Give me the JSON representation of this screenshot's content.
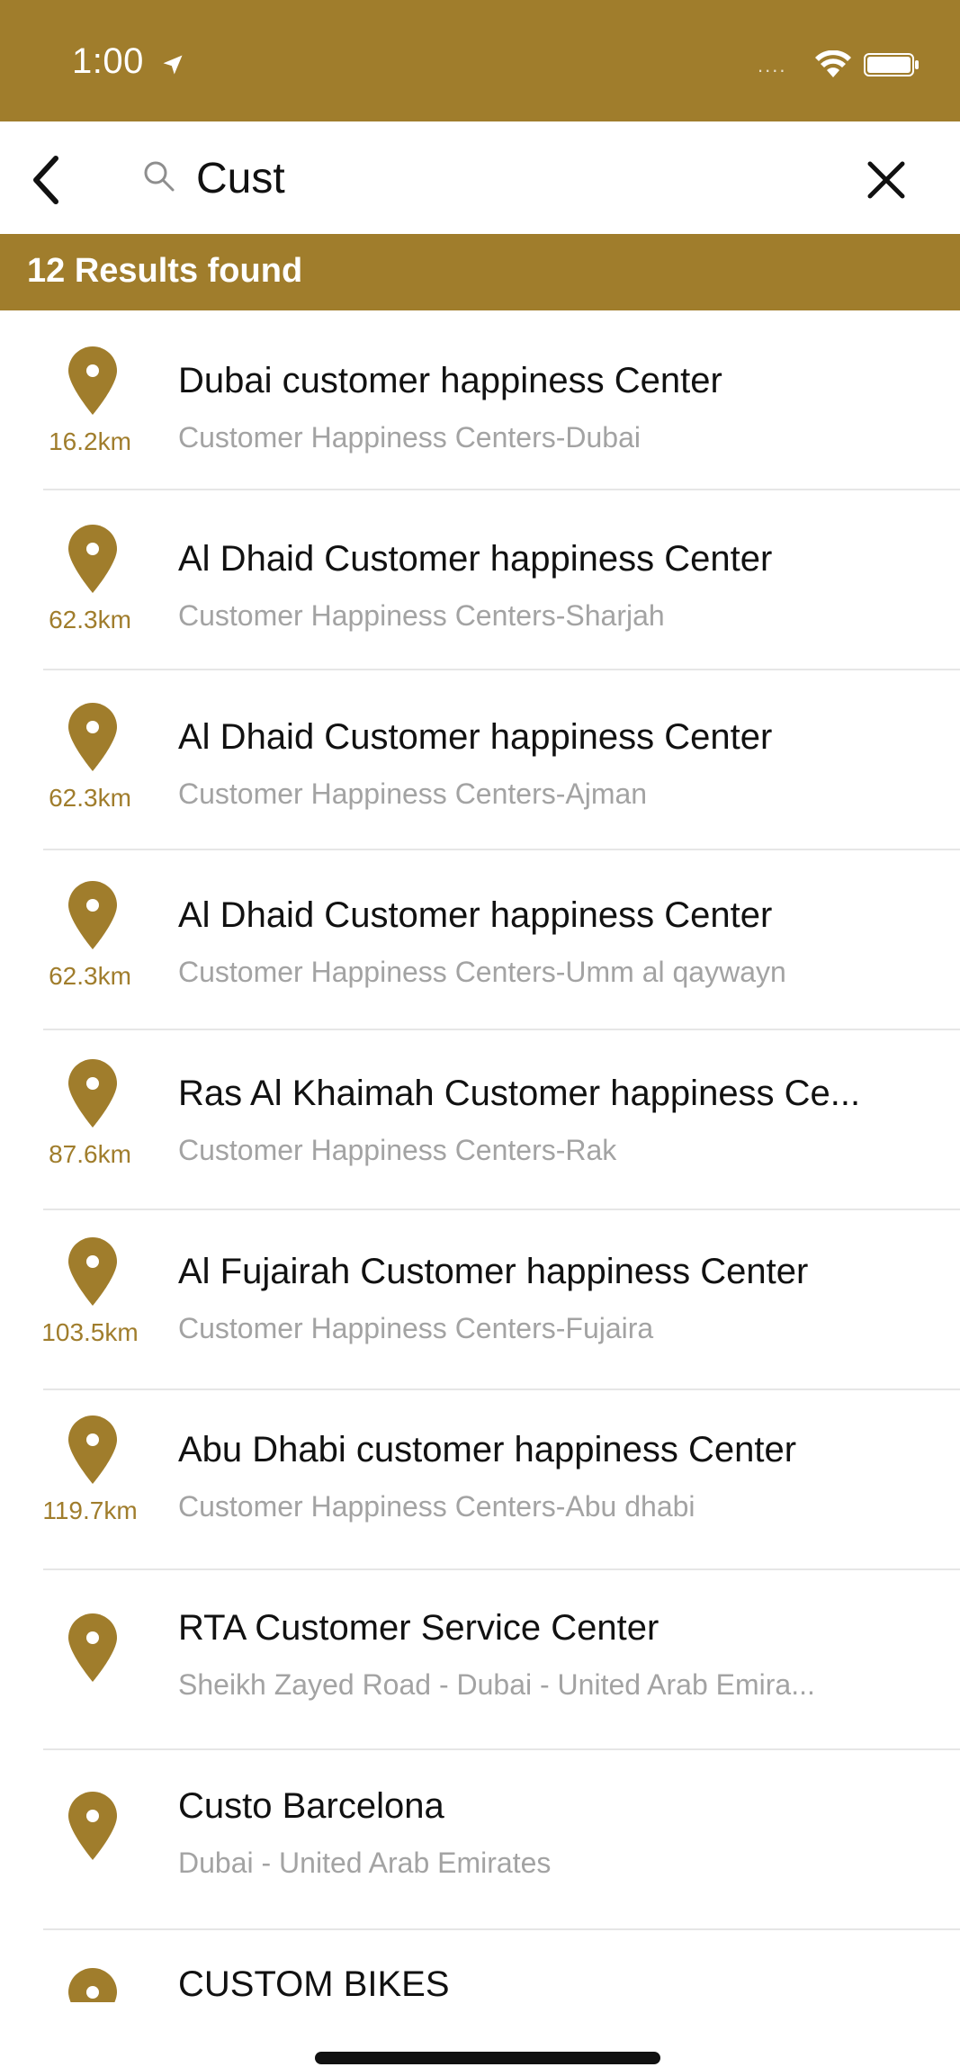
{
  "status_bar": {
    "time": "1:00",
    "location_icon": "location-arrow-icon",
    "dots": "....",
    "wifi_icon": "wifi-icon",
    "battery_icon": "battery-icon"
  },
  "search": {
    "back_icon": "chevron-left-icon",
    "search_icon": "search-icon",
    "value": "Cust",
    "clear_icon": "close-icon"
  },
  "results": {
    "label": "12 Results found"
  },
  "colors": {
    "brand": "#a07d2c",
    "subtitle": "#a3a3a3"
  },
  "items": [
    {
      "title": "Dubai customer happiness Center",
      "subtitle": "Customer Happiness Centers-Dubai",
      "distance": "16.2km"
    },
    {
      "title": "Al Dhaid Customer happiness Center",
      "subtitle": "Customer Happiness Centers-Sharjah",
      "distance": "62.3km"
    },
    {
      "title": "Al Dhaid Customer happiness Center",
      "subtitle": "Customer Happiness Centers-Ajman",
      "distance": "62.3km"
    },
    {
      "title": "Al Dhaid Customer happiness Center",
      "subtitle": "Customer Happiness Centers-Umm al qaywayn",
      "distance": "62.3km"
    },
    {
      "title": "Ras Al Khaimah Customer happiness Ce...",
      "subtitle": "Customer Happiness Centers-Rak",
      "distance": "87.6km"
    },
    {
      "title": "Al Fujairah Customer happiness Center",
      "subtitle": "Customer Happiness Centers-Fujaira",
      "distance": "103.5km"
    },
    {
      "title": "Abu Dhabi customer happiness Center",
      "subtitle": "Customer Happiness Centers-Abu dhabi",
      "distance": "119.7km"
    },
    {
      "title": "RTA Customer Service Center",
      "subtitle": "Sheikh Zayed Road - Dubai - United Arab Emira...",
      "distance": ""
    },
    {
      "title": "Custo Barcelona",
      "subtitle": "Dubai - United Arab Emirates",
      "distance": ""
    },
    {
      "title": "CUSTOM BIKES",
      "subtitle": "",
      "distance": ""
    }
  ]
}
